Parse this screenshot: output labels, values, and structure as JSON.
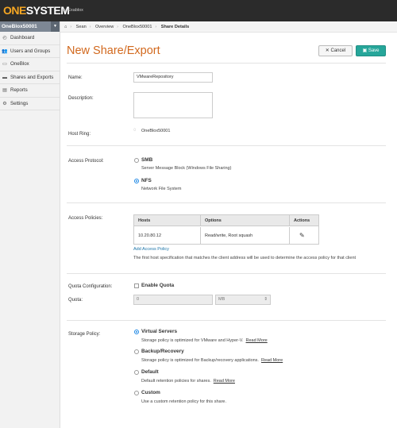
{
  "header": {
    "logo_part1": "ONE",
    "logo_part2": "SYSTEM",
    "logo_by": "by Exablox"
  },
  "sidebar": {
    "node": "OneBlox50001",
    "node_caret_icon": "chevron-down-icon",
    "items": [
      {
        "label": "Dashboard",
        "icon": "dashboard-icon"
      },
      {
        "label": "Users and Groups",
        "icon": "users-icon"
      },
      {
        "label": "OneBlox",
        "icon": "oneblox-icon"
      },
      {
        "label": "Shares and Exports",
        "icon": "folder-icon"
      },
      {
        "label": "Reports",
        "icon": "reports-icon"
      },
      {
        "label": "Settings",
        "icon": "gear-icon"
      }
    ]
  },
  "breadcrumb": [
    "Sean",
    "Overview",
    "OneBlox50001",
    "Share Details"
  ],
  "page": {
    "title": "New Share/Export",
    "cancel_label": "Cancel",
    "save_label": "Save"
  },
  "form": {
    "name_label": "Name:",
    "name_value": "VMwareRepository",
    "description_label": "Description:",
    "host_ring_label": "Host Ring:",
    "host_ring_value": "OneBlox50001",
    "access_protocol_label": "Access Protocol:",
    "protocols": [
      {
        "title": "SMB",
        "desc": "Server Message Block (Windows File Sharing)",
        "selected": false
      },
      {
        "title": "NFS",
        "desc": "Network File System",
        "selected": true
      }
    ],
    "access_policies_label": "Access Policies:",
    "policy_headers": [
      "Hosts",
      "Options",
      "Actions"
    ],
    "policy_rows": [
      {
        "hosts": "10.20.80.12",
        "options": "Read/write, Root squash",
        "action_icon": "pencil-icon"
      }
    ],
    "add_policy_label": "Add Access Policy",
    "policy_hint": "The first host specification that matches the client address will be used to determine the access policy for that client",
    "quota_config_label": "Quota Configuration:",
    "enable_quota_label": "Enable Quota",
    "quota_label": "Quota:",
    "quota_value": "0",
    "quota_unit": "MB",
    "storage_policy_label": "Storage Policy:",
    "storage_policies": [
      {
        "title": "Virtual Servers",
        "desc": "Storage policy is optimized for VMware and Hyper-V.",
        "read_more": "Read More",
        "selected": true
      },
      {
        "title": "Backup/Recovery",
        "desc": "Storage policy is optimized for Backup/recovery applications.",
        "read_more": "Read More",
        "selected": false
      },
      {
        "title": "Default",
        "desc": "Default retention policies for shares.",
        "read_more": "Read More",
        "selected": false
      },
      {
        "title": "Custom",
        "desc": "Use a custom retention policy for this share.",
        "read_more": "",
        "selected": false
      }
    ]
  },
  "colors": {
    "title": "#d2691e",
    "save": "#26a69a",
    "logo_accent": "#f5a623",
    "radio_selected": "#1e88e5"
  }
}
